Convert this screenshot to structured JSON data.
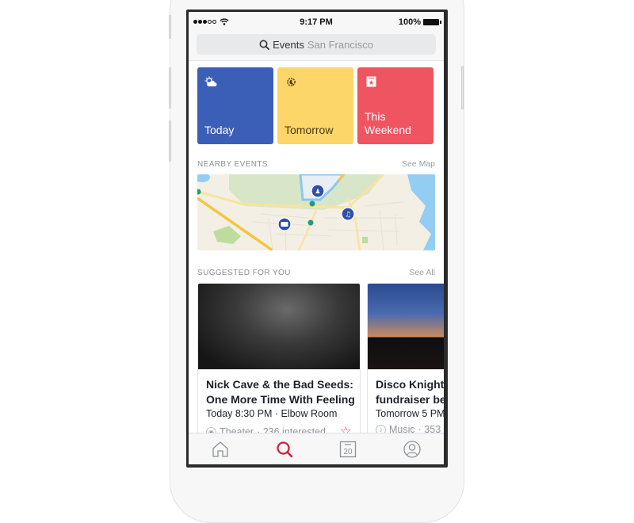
{
  "status_bar": {
    "signal_bars_filled": 3,
    "signal_bars_total": 5,
    "time": "9:17 PM",
    "battery": "100%"
  },
  "search": {
    "icon": "search-icon",
    "query": "Events",
    "location": "San Francisco"
  },
  "quick_filters": [
    {
      "label": "Today",
      "icon": "weather-partly-cloudy-icon",
      "color": "#3b5fb6",
      "text_color": "#ffffff"
    },
    {
      "label": "Tomorrow",
      "icon": "moon-sun-icon",
      "color": "#fcd669",
      "text_color": "#4b3a12"
    },
    {
      "label": "This\nWeekend",
      "icon": "calendar-star-icon",
      "color": "#ef5461",
      "text_color": "#ffffff"
    }
  ],
  "nearby": {
    "title": "NEARBY EVENTS",
    "link": "See Map",
    "markers": [
      {
        "icon": "people-icon",
        "category": "group"
      },
      {
        "icon": "music-icon",
        "category": "music"
      },
      {
        "icon": "film-icon",
        "category": "theater"
      }
    ]
  },
  "suggested": {
    "title": "SUGGESTED FOR YOU",
    "link": "See All",
    "events": [
      {
        "title_line1": "Nick Cave & the Bad Seeds:",
        "title_line2": "One More Time With Feeling",
        "when_where": "Today 8:30 PM · Elbow Room",
        "category": "Theater",
        "category_icon": "theater-icon",
        "interested": "· 236 interested",
        "starred": false
      },
      {
        "title_line1": "Disco Knights",
        "title_line2": "fundraiser be",
        "when_where": "Tomorrow 5 PM",
        "category": "Music",
        "category_icon": "music-note-icon",
        "interested": "· 353"
      }
    ]
  },
  "tab_bar": {
    "tabs": [
      {
        "name": "home",
        "icon": "home-icon",
        "active": false
      },
      {
        "name": "search",
        "icon": "search-icon",
        "active": true
      },
      {
        "name": "calendar",
        "icon": "calendar-icon",
        "badge": "20",
        "active": false
      },
      {
        "name": "profile",
        "icon": "profile-icon",
        "active": false
      }
    ],
    "active_color": "#d0223d",
    "inactive_color": "#8d9096"
  }
}
